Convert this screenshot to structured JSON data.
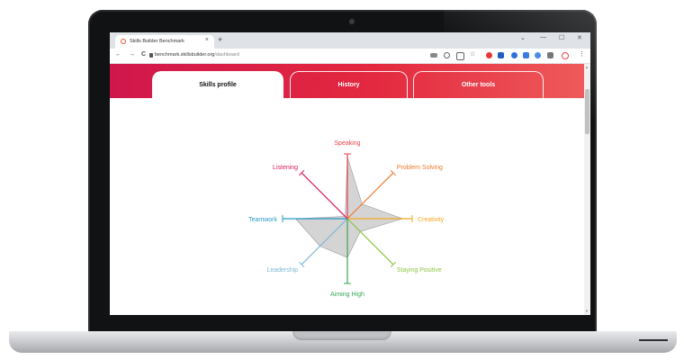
{
  "browser": {
    "tab_title": "Skills Builder Benchmark",
    "tab_close": "×",
    "new_tab": "+",
    "url_host": "benchmark.skillsbuilder.org",
    "url_path": "/dashboard",
    "nav": {
      "back": "←",
      "forward": "→",
      "reload": "C"
    },
    "window_controls": {
      "chevron": "⌄",
      "minimize": "—",
      "maximize": "☐",
      "close": "✕"
    }
  },
  "page": {
    "tabs": [
      {
        "label": "Skills profile",
        "active": true
      },
      {
        "label": "History",
        "active": false
      },
      {
        "label": "Other tools",
        "active": false
      }
    ]
  },
  "radar": {
    "axes": [
      {
        "label": "Speaking",
        "color": "#e8434b",
        "value": 0.95
      },
      {
        "label": "Problem Solving",
        "color": "#f07a2e",
        "value": 0.32
      },
      {
        "label": "Creativity",
        "color": "#f5a623",
        "value": 0.85
      },
      {
        "label": "Staying Positive",
        "color": "#8cc63f",
        "value": 0.28
      },
      {
        "label": "Aiming High",
        "color": "#3aa655",
        "value": 0.6
      },
      {
        "label": "Leadership",
        "color": "#7fb8d6",
        "value": 0.6
      },
      {
        "label": "Teamwork",
        "color": "#2b9bc9",
        "value": 0.8
      },
      {
        "label": "Listening",
        "color": "#d81b60",
        "value": 0.05
      }
    ]
  },
  "colors": {
    "banner_start": "#d0174c",
    "banner_end": "#ee5a5a",
    "polygon_fill": "#cccccc"
  }
}
